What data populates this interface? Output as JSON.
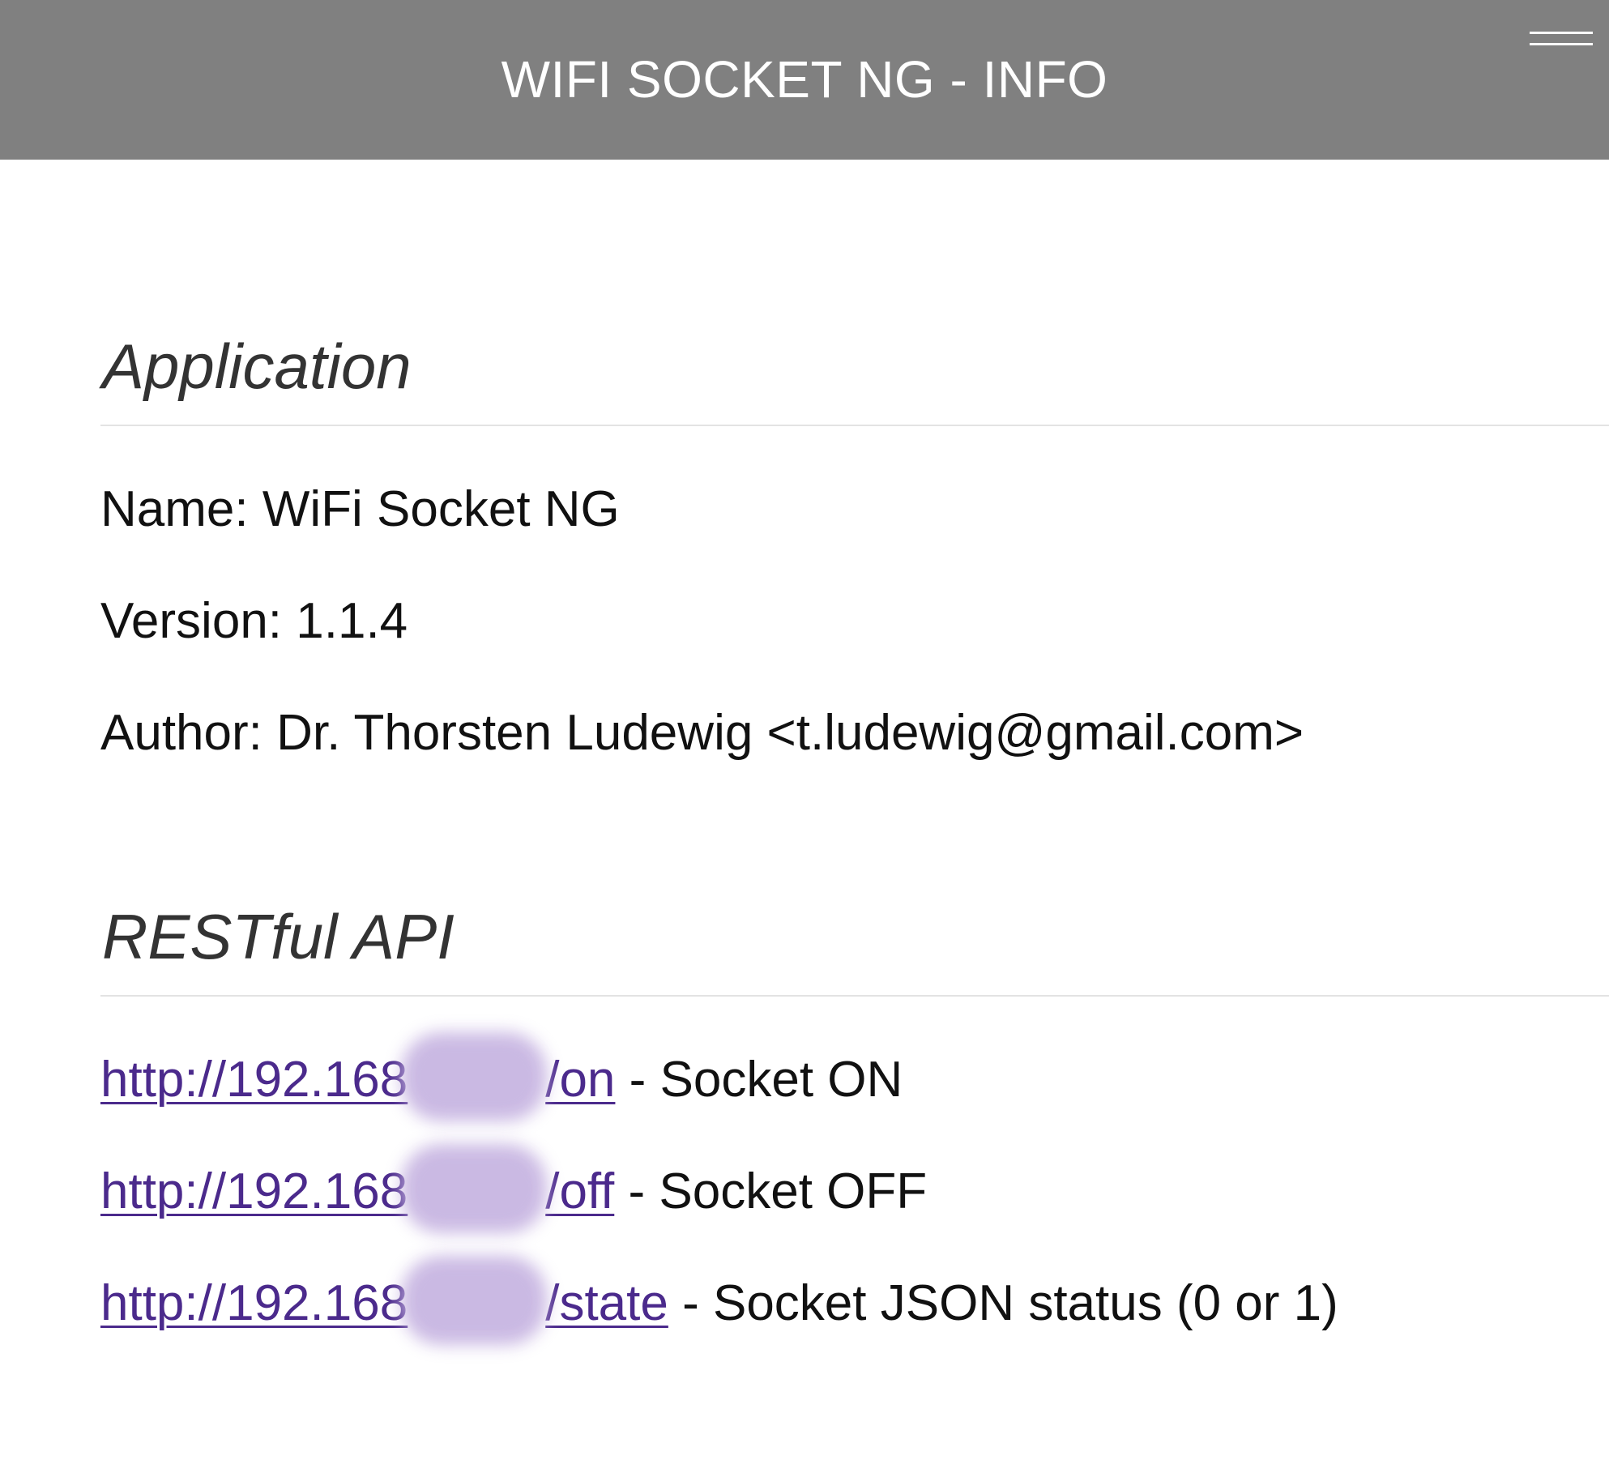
{
  "header": {
    "title": "WIFI SOCKET NG - INFO",
    "menu_icon": "hamburger-icon",
    "background": "#808080"
  },
  "application": {
    "heading": "Application",
    "name_label": "Name:",
    "name_value": "WiFi Socket NG",
    "version_label": "Version:",
    "version_value": "1.1.4",
    "author_label": "Author:",
    "author_value": "Dr. Thorsten Ludewig <t.ludewig@gmail.com>"
  },
  "api": {
    "heading": "RESTful API",
    "link_color": "#4b2a8c",
    "endpoints": [
      {
        "prefix": "http://192.168",
        "path": "/on",
        "description": "- Socket ON"
      },
      {
        "prefix": "http://192.168",
        "path": "/off",
        "description": "- Socket OFF"
      },
      {
        "prefix": "http://192.168",
        "path": "/state",
        "description": "- Socket JSON status (0 or 1)"
      }
    ]
  }
}
